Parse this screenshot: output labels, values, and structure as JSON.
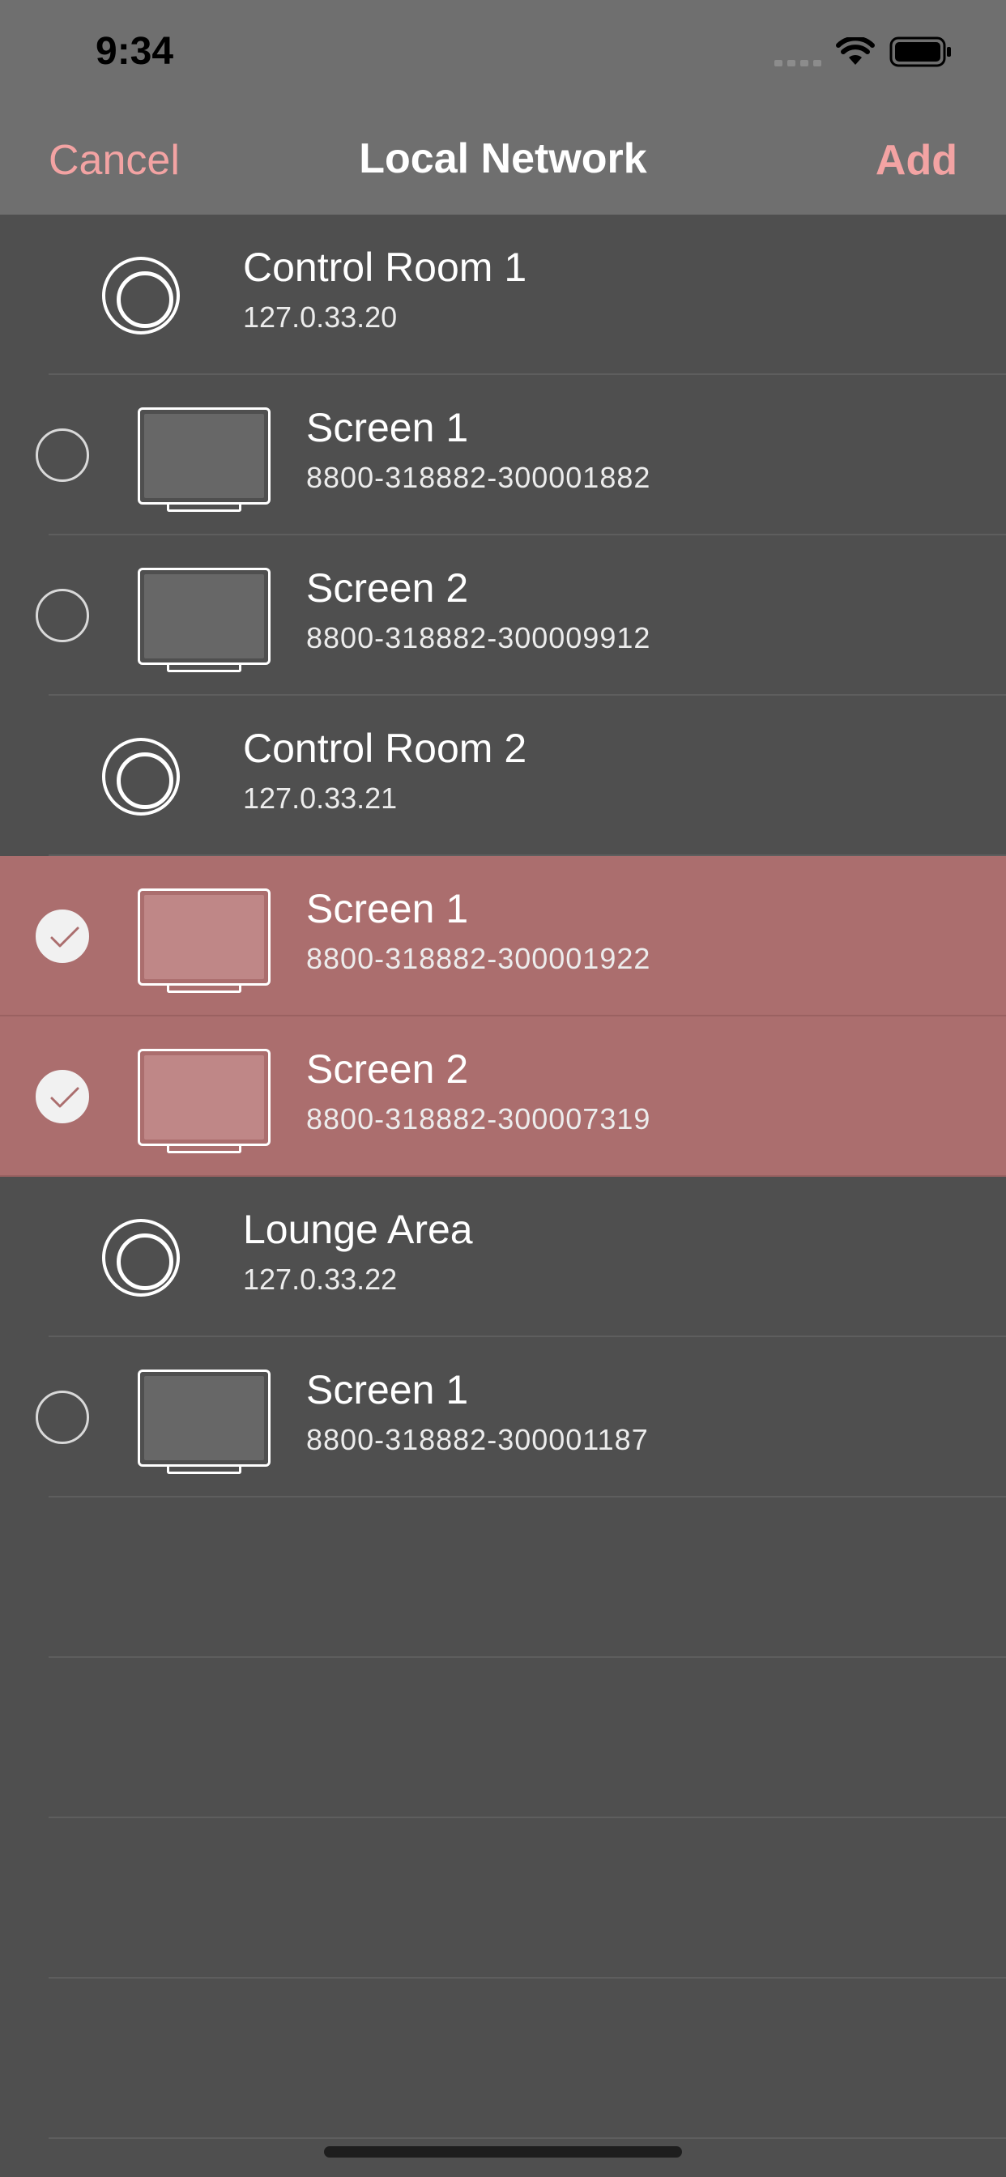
{
  "status_bar": {
    "time": "9:34"
  },
  "nav": {
    "cancel": "Cancel",
    "title": "Local Network",
    "add": "Add"
  },
  "colors": {
    "accent": "#f3a3a3",
    "selected_row": "#ab6e6e",
    "background": "#4f4f4f",
    "header": "#6f6f6f"
  },
  "rows": [
    {
      "kind": "group",
      "name": "Control Room 1",
      "sub": "127.0.33.20",
      "icon": "group-radio-icon"
    },
    {
      "kind": "screen",
      "name": "Screen 1",
      "sub": "8800-318882-300001882",
      "checked": false,
      "icon": "tv-screen-icon"
    },
    {
      "kind": "screen",
      "name": "Screen 2",
      "sub": "8800-318882-300009912",
      "checked": false,
      "icon": "tv-screen-icon"
    },
    {
      "kind": "group",
      "name": "Control Room 2",
      "sub": "127.0.33.21",
      "icon": "group-radio-icon"
    },
    {
      "kind": "screen",
      "name": "Screen 1",
      "sub": "8800-318882-300001922",
      "checked": true,
      "icon": "tv-screen-icon"
    },
    {
      "kind": "screen",
      "name": "Screen 2",
      "sub": "8800-318882-300007319",
      "checked": true,
      "icon": "tv-screen-icon"
    },
    {
      "kind": "group",
      "name": "Lounge Area",
      "sub": "127.0.33.22",
      "icon": "group-radio-icon"
    },
    {
      "kind": "screen",
      "name": "Screen 1",
      "sub": "8800-318882-300001187",
      "checked": false,
      "icon": "tv-screen-icon"
    }
  ]
}
